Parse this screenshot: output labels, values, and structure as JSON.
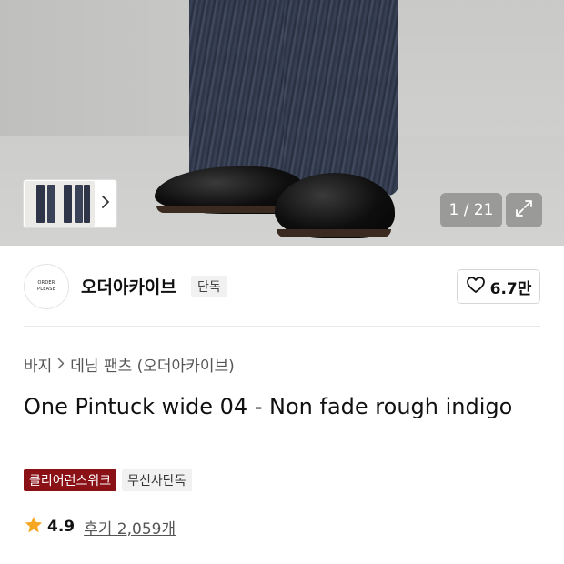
{
  "gallery": {
    "counter": "1 / 21",
    "thumb_next_icon": "chevron-right-icon",
    "expand_icon": "expand-icon"
  },
  "brand": {
    "logo_line1": "ORDER",
    "logo_line2": "PLEASE",
    "name": "오더아카이브",
    "tag": "단독",
    "like_icon": "heart-outline-icon",
    "like_count": "6.7만"
  },
  "breadcrumb": {
    "category": "바지",
    "subcategory": "데님 팬츠 (오더아카이브)"
  },
  "product": {
    "title": "One Pintuck wide 04 - Non fade rough indigo",
    "badges": [
      "클리어런스위크",
      "무신사단독"
    ],
    "rating": "4.9",
    "reviews": "후기 2,059개"
  },
  "colors": {
    "badge_red": "#8a1116",
    "star": "#f5a623"
  }
}
